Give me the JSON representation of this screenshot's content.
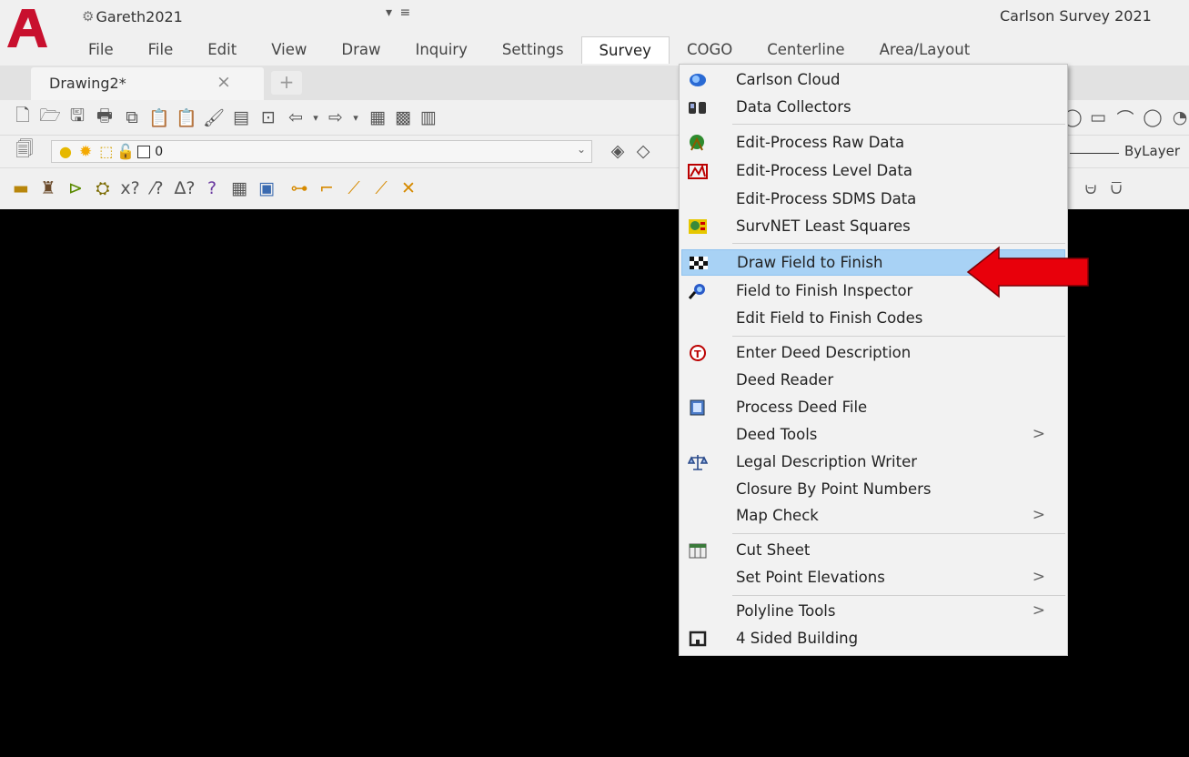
{
  "title_bar": {
    "profile_name": "Gareth2021",
    "app_title": "Carlson Survey 2021"
  },
  "menubar": {
    "items": [
      "File",
      "File",
      "Edit",
      "View",
      "Draw",
      "Inquiry",
      "Settings",
      "Survey",
      "COGO",
      "Centerline",
      "Area/Layout"
    ],
    "active": "Survey"
  },
  "tabs": {
    "document": "Drawing2*",
    "close_glyph": "×",
    "new_tab_glyph": "+"
  },
  "layer_toolbar": {
    "layer_name": "0",
    "linetype": "ByLayer"
  },
  "survey_menu": {
    "items": [
      {
        "label": "Carlson Cloud",
        "icon": "cloud-icon"
      },
      {
        "label": "Data Collectors",
        "icon": "data-collector-icon"
      },
      {
        "label": "Edit-Process Raw Data",
        "icon": "raw-data-icon"
      },
      {
        "label": "Edit-Process Level Data",
        "icon": "level-data-icon"
      },
      {
        "label": "Edit-Process SDMS Data",
        "icon": ""
      },
      {
        "label": "SurvNET Least Squares",
        "icon": "survnet-icon"
      },
      {
        "label": "Draw Field to Finish",
        "icon": "checkered-flag-icon",
        "highlighted": true
      },
      {
        "label": "Field to Finish Inspector",
        "icon": "inspector-icon"
      },
      {
        "label": "Edit Field to Finish Codes",
        "icon": ""
      },
      {
        "label": "Enter Deed Description",
        "icon": "deed-description-icon"
      },
      {
        "label": "Deed Reader",
        "icon": ""
      },
      {
        "label": "Process Deed File",
        "icon": "deed-file-icon"
      },
      {
        "label": "Deed Tools",
        "icon": "",
        "submenu": true
      },
      {
        "label": "Legal Description Writer",
        "icon": "scales-icon"
      },
      {
        "label": "Closure By Point Numbers",
        "icon": ""
      },
      {
        "label": "Map Check",
        "icon": "",
        "submenu": true
      },
      {
        "label": "Cut Sheet",
        "icon": "cut-sheet-icon"
      },
      {
        "label": "Set Point Elevations",
        "icon": "",
        "submenu": true
      },
      {
        "label": "Polyline Tools",
        "icon": "",
        "submenu": true
      },
      {
        "label": "4 Sided Building",
        "icon": "building-icon"
      }
    ],
    "submenu_glyph": ">"
  },
  "colors": {
    "highlight": "#a8d2f5",
    "annotation_arrow": "#e8000b",
    "canvas": "#000000",
    "logo": "#c8102e"
  }
}
